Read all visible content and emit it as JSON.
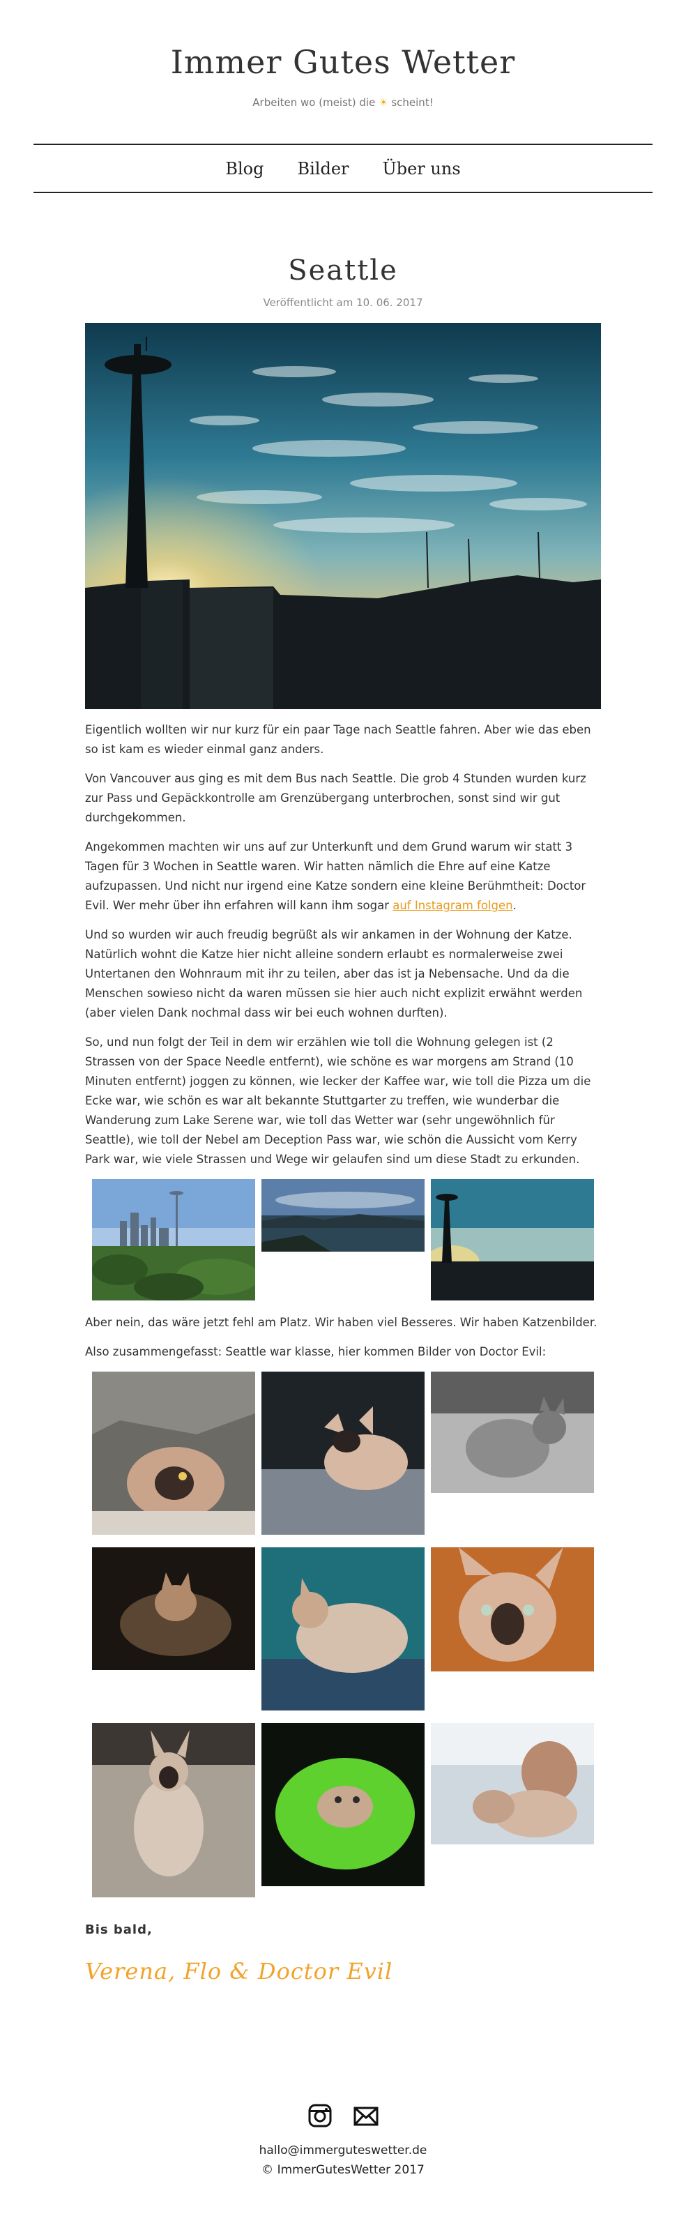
{
  "site": {
    "title": "Immer Gutes Wetter",
    "tagline_before": "Arbeiten wo (meist) die",
    "tagline_after": "scheint!"
  },
  "nav": {
    "items": [
      "Blog",
      "Bilder",
      "Über uns"
    ]
  },
  "post": {
    "title": "Seattle",
    "date": "Veröffentlicht am 10. 06. 2017",
    "paragraphs": [
      "Eigentlich wollten wir nur kurz für ein paar Tage nach Seattle fahren. Aber wie das eben so ist kam es wieder einmal ganz anders.",
      "Von Vancouver aus ging es mit dem Bus nach Seattle. Die grob 4 Stunden wurden kurz zur Pass und Gepäckkontrolle am Grenzübergang unterbrochen, sonst sind wir gut durchgekommen.",
      "Angekommen machten wir uns auf zur Unterkunft und dem Grund warum wir statt 3 Tagen für 3 Wochen in Seattle waren. Wir hatten nämlich die Ehre auf eine Katze aufzupassen. Und nicht nur irgend eine Katze sondern eine kleine Berühmtheit: Doctor Evil. Wer mehr über ihn erfahren will kann ihm sogar",
      "auf Instagram folgen",
      ".",
      "Und so wurden wir auch freudig begrüßt als wir ankamen in der Wohnung der Katze. Natürlich wohnt die Katze hier nicht alleine sondern erlaubt es normalerweise zwei Untertanen den Wohnraum mit ihr zu teilen, aber das ist ja Nebensache. Und da die Menschen sowieso nicht da waren müssen sie hier auch nicht explizit erwähnt werden (aber vielen Dank nochmal dass wir bei euch wohnen durften).",
      "So, und nun folgt der Teil in dem wir erzählen wie toll die Wohnung gelegen ist (2 Strassen von der Space Needle entfernt), wie schöne es war morgens am Strand (10 Minuten entfernt) joggen zu können, wie lecker der Kaffee war, wie toll die Pizza um die Ecke war, wie schön es war alt bekannte Stuttgarter zu treffen, wie wunderbar die Wanderung zum Lake Serene war, wie toll das Wetter war (sehr ungewöhnlich für Seattle), wie toll der Nebel am Deception Pass war, wie schön die Aussicht vom Kerry Park war, wie viele Strassen und Wege wir gelaufen sind um diese Stadt zu erkunden.",
      "Aber nein, das wäre jetzt fehl am Platz. Wir haben viel Besseres. Wir haben Katzenbilder.",
      "Also zusammengefasst: Seattle war klasse, hier kommen Bilder von Doctor Evil:"
    ],
    "signoff": "Bis bald,",
    "signature": "Verena, Flo & Doctor Evil"
  },
  "footer": {
    "email": "hallo@immerguteswetter.de",
    "copyright": "© ImmerGutesWetter 2017"
  },
  "icons": {
    "instagram": "instagram-icon",
    "mail": "mail-icon",
    "sun": "sun-icon"
  },
  "colors": {
    "accent": "#e89a1c",
    "signature": "#f1a32a",
    "text": "#333333"
  }
}
